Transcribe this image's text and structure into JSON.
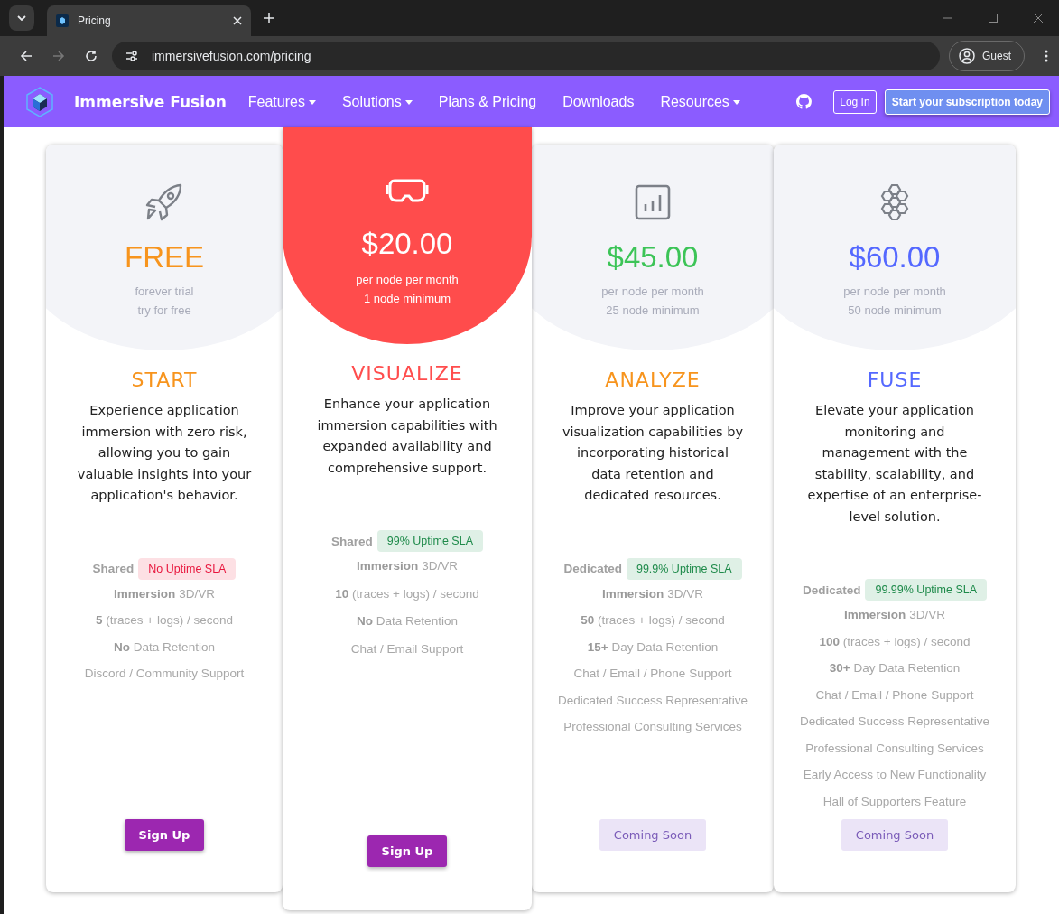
{
  "browser": {
    "tab_title": "Pricing",
    "url": "immersivefusion.com/pricing",
    "profile": "Guest"
  },
  "nav": {
    "brand": "Immersive Fusion",
    "items": [
      {
        "label": "Features",
        "dropdown": true
      },
      {
        "label": "Solutions",
        "dropdown": true
      },
      {
        "label": "Plans & Pricing",
        "dropdown": false
      },
      {
        "label": "Downloads",
        "dropdown": false
      },
      {
        "label": "Resources",
        "dropdown": true
      }
    ],
    "login": "Log In",
    "cta": "Start your subscription today"
  },
  "plans": [
    {
      "featured": false,
      "price": "FREE",
      "subtitle": [
        "forever trial",
        "try for free"
      ],
      "tier": "START",
      "description": "Experience application immersion with zero risk, allowing you to gain valuable insights into your application's behavior.",
      "hosting": "Shared",
      "sla": {
        "label": "No Uptime SLA",
        "kind": "none"
      },
      "features": [
        "**Immersion** 3D/VR",
        "**5** (traces + logs) / second",
        "**No** Data Retention",
        "Discord / Community Support"
      ],
      "button": {
        "label": "Sign Up",
        "disabled": false
      }
    },
    {
      "featured": true,
      "price": "$20.00",
      "subtitle": [
        "per node per month",
        "1 node minimum"
      ],
      "tier": "VISUALIZE",
      "description": "Enhance your application immersion capabilities with expanded availability and comprehensive support.",
      "hosting": "Shared",
      "sla": {
        "label": "99% Uptime SLA",
        "kind": "uptime"
      },
      "features": [
        "**Immersion** 3D/VR",
        "**10** (traces + logs) / second",
        "**No** Data Retention",
        "Chat / Email Support"
      ],
      "button": {
        "label": "Sign Up",
        "disabled": false
      }
    },
    {
      "featured": false,
      "price": "$45.00",
      "subtitle": [
        "per node per month",
        "25 node minimum"
      ],
      "tier": "ANALYZE",
      "description": "Improve your application visualization capabilities by incorporating historical data retention and dedicated resources.",
      "hosting": "Dedicated",
      "sla": {
        "label": "99.9% Uptime SLA",
        "kind": "uptime"
      },
      "features": [
        "**Immersion** 3D/VR",
        "**50** (traces + logs) / second",
        "**15+** Day Data Retention",
        "Chat / Email / Phone Support",
        "Dedicated Success Representative",
        "Professional Consulting Services"
      ],
      "button": {
        "label": "Coming Soon",
        "disabled": true
      }
    },
    {
      "featured": false,
      "price": "$60.00",
      "subtitle": [
        "per node per month",
        "50 node minimum"
      ],
      "tier": "FUSE",
      "description": "Elevate your application monitoring and management with the stability, scalability, and expertise of an enterprise-level solution.",
      "hosting": "Dedicated",
      "sla": {
        "label": "99.99% Uptime SLA",
        "kind": "uptime"
      },
      "features": [
        "**Immersion** 3D/VR",
        "**100** (traces + logs) / second",
        "**30+** Day Data Retention",
        "Chat / Email / Phone Support",
        "Dedicated Success Representative",
        "Professional Consulting Services",
        "Early Access to New Functionality",
        "Hall of Supporters Feature"
      ],
      "button": {
        "label": "Coming Soon",
        "disabled": true
      }
    }
  ]
}
